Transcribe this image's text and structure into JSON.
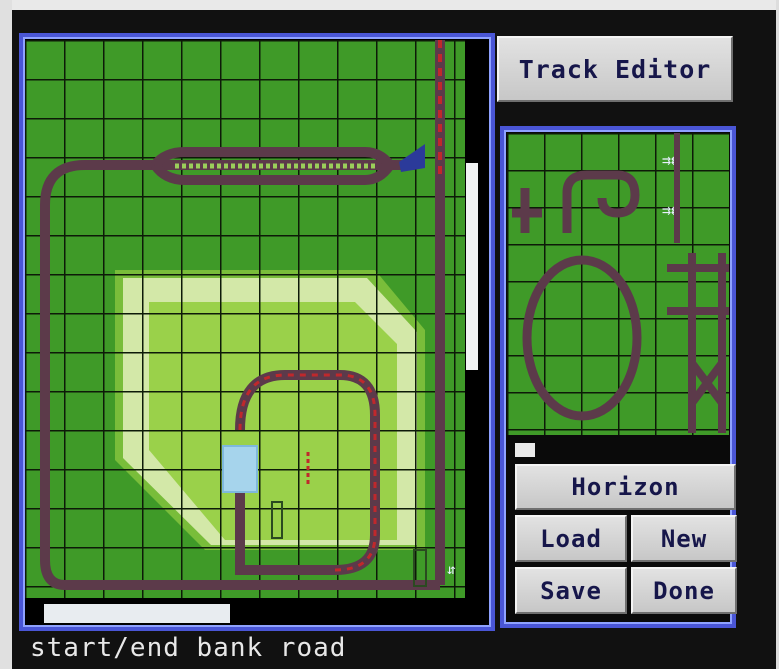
{
  "window": {
    "title": "Track Editor"
  },
  "palette": {
    "theme_label": "Horizon"
  },
  "buttons": {
    "load": "Load",
    "new": "New",
    "save": "Save",
    "done": "Done"
  },
  "status_bar": {
    "text": "start/end bank road"
  },
  "colors": {
    "grass_dark": "#3f9a28",
    "grass_light": "#9ad14a",
    "road": "#5c3a4a",
    "bank_red": "#c0282c",
    "frame_blue": "#4a56d6",
    "button_face": "#d2d2d2",
    "button_text": "#16164a"
  }
}
